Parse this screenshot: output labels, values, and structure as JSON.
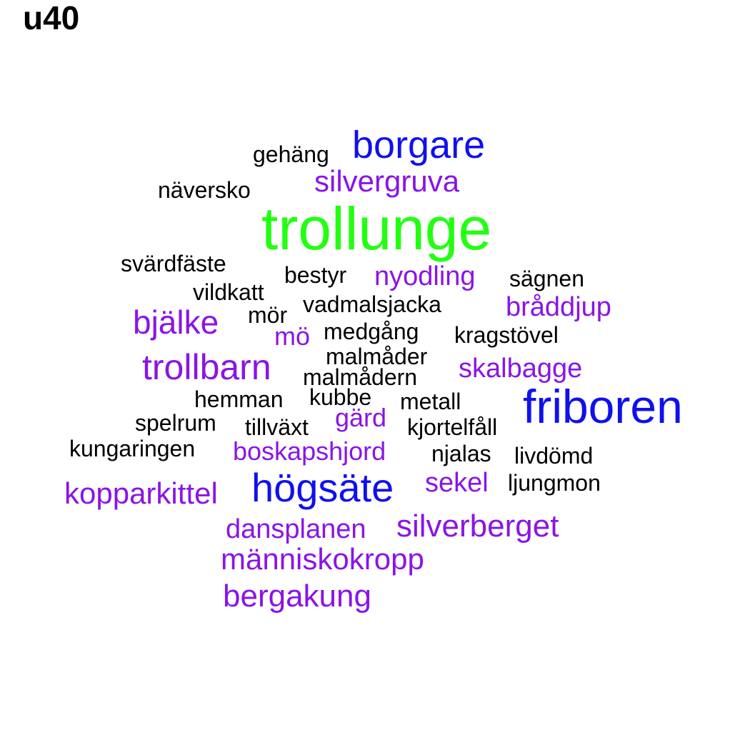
{
  "title": "u40",
  "colors": {
    "green": "#22ff11",
    "blue": "#1010ee",
    "purple": "#8a14e6",
    "black": "#000000"
  },
  "words": [
    {
      "text": "trollunge",
      "color": "green"
    },
    {
      "text": "borgare",
      "color": "blue"
    },
    {
      "text": "friboren",
      "color": "blue"
    },
    {
      "text": "högsäte",
      "color": "blue"
    },
    {
      "text": "silvergruva",
      "color": "purple"
    },
    {
      "text": "bjälke",
      "color": "purple"
    },
    {
      "text": "trollbarn",
      "color": "purple"
    },
    {
      "text": "kopparkittel",
      "color": "purple"
    },
    {
      "text": "silverberget",
      "color": "purple"
    },
    {
      "text": "människokropp",
      "color": "purple"
    },
    {
      "text": "bergakung",
      "color": "purple"
    },
    {
      "text": "nyodling",
      "color": "purple"
    },
    {
      "text": "bråddjup",
      "color": "purple"
    },
    {
      "text": "skalbagge",
      "color": "purple"
    },
    {
      "text": "dansplanen",
      "color": "purple"
    },
    {
      "text": "boskapshjord",
      "color": "purple"
    },
    {
      "text": "gärd",
      "color": "purple"
    },
    {
      "text": "sekel",
      "color": "purple"
    },
    {
      "text": "mö",
      "color": "purple"
    },
    {
      "text": "gehäng",
      "color": "black"
    },
    {
      "text": "näversko",
      "color": "black"
    },
    {
      "text": "svärdfäste",
      "color": "black"
    },
    {
      "text": "bestyr",
      "color": "black"
    },
    {
      "text": "sägnen",
      "color": "black"
    },
    {
      "text": "vildkatt",
      "color": "black"
    },
    {
      "text": "mör",
      "color": "black"
    },
    {
      "text": "vadmalsjacka",
      "color": "black"
    },
    {
      "text": "medgång",
      "color": "black"
    },
    {
      "text": "kragstövel",
      "color": "black"
    },
    {
      "text": "malmåder",
      "color": "black"
    },
    {
      "text": "malmådern",
      "color": "black"
    },
    {
      "text": "hemman",
      "color": "black"
    },
    {
      "text": "kubbe",
      "color": "black"
    },
    {
      "text": "metall",
      "color": "black"
    },
    {
      "text": "spelrum",
      "color": "black"
    },
    {
      "text": "tillväxt",
      "color": "black"
    },
    {
      "text": "kjortelfåll",
      "color": "black"
    },
    {
      "text": "kungaringen",
      "color": "black"
    },
    {
      "text": "njalas",
      "color": "black"
    },
    {
      "text": "livdömd",
      "color": "black"
    },
    {
      "text": "ljungmon",
      "color": "black"
    }
  ]
}
